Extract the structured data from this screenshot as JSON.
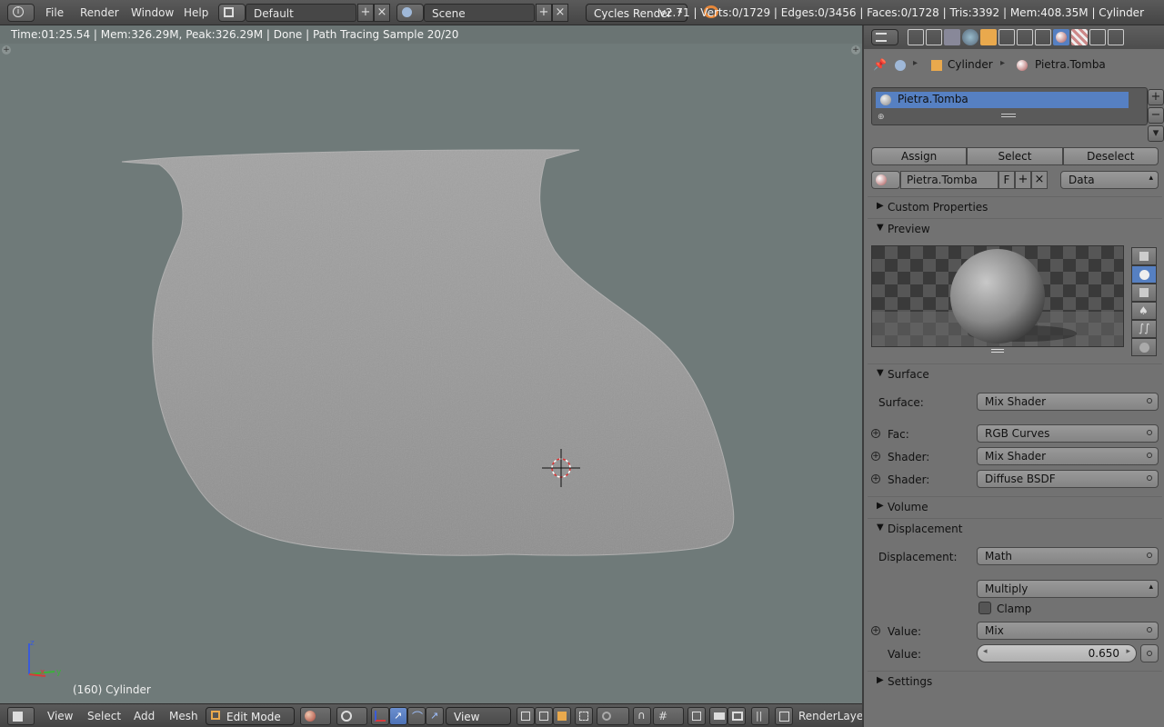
{
  "topbar": {
    "menus": [
      "File",
      "Render",
      "Window",
      "Help"
    ],
    "screen_layout": "Default",
    "scene": "Scene",
    "render_engine": "Cycles Render",
    "stats": "v2.71 | Verts:0/1729 | Edges:0/3456 | Faces:0/1728 | Tris:3392 | Mem:408.35M | Cylinder"
  },
  "viewport": {
    "render_info": "Time:01:25.54 | Mem:326.29M, Peak:326.29M | Done | Path Tracing Sample 20/20",
    "object_label": "(160) Cylinder",
    "axis_x": "x",
    "axis_y": "y",
    "axis_z": "z"
  },
  "bottombar": {
    "menus": [
      "View",
      "Select",
      "Add",
      "Mesh"
    ],
    "mode": "Edit Mode",
    "transform_orientation": "View",
    "render_layer": "RenderLayer"
  },
  "props": {
    "breadcrumb_object": "Cylinder",
    "breadcrumb_material": "Pietra.Tomba",
    "slot_name": "Pietra.Tomba",
    "assign_label": "Assign",
    "select_label": "Select",
    "deselect_label": "Deselect",
    "material_name": "Pietra.Tomba",
    "fake_user_label": "F",
    "link_type": "Data",
    "sections": {
      "custom_properties": "Custom Properties",
      "preview": "Preview",
      "surface": "Surface",
      "volume": "Volume",
      "displacement": "Displacement",
      "settings": "Settings"
    },
    "surface": {
      "surface_label": "Surface:",
      "surface_value": "Mix Shader",
      "fac_label": "Fac:",
      "fac_value": "RGB Curves",
      "shader1_label": "Shader:",
      "shader1_value": "Mix Shader",
      "shader2_label": "Shader:",
      "shader2_value": "Diffuse BSDF"
    },
    "displacement": {
      "displacement_label": "Displacement:",
      "displacement_value": "Math",
      "operation": "Multiply",
      "clamp_label": "Clamp",
      "clamp_checked": false,
      "value1_label": "Value:",
      "value1_value": "Mix",
      "value2_label": "Value:",
      "value2_value": "0.650"
    }
  },
  "colors": {
    "viewport_bg": "#6f7a79",
    "panel_bg": "#727272",
    "accent_blue": "#5680c2",
    "header_bg": "#4d4d4d"
  }
}
